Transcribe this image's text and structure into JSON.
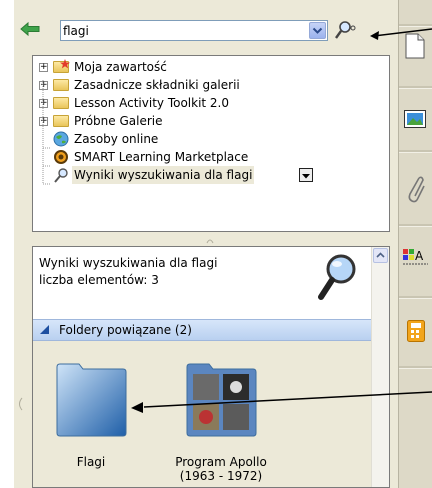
{
  "search": {
    "value": "flagi"
  },
  "tree": {
    "items": [
      {
        "label": "Moja zawartość"
      },
      {
        "label": "Zasadnicze składniki galerii"
      },
      {
        "label": "Lesson Activity Toolkit 2.0"
      },
      {
        "label": "Próbne Galerie"
      },
      {
        "label": "Zasoby online"
      },
      {
        "label": "SMART Learning Marketplace"
      },
      {
        "label": "Wyniki wyszukiwania dla flagi"
      }
    ]
  },
  "results": {
    "title": "Wyniki wyszukiwania dla flagi",
    "count": "liczba elementów: 3",
    "group_label": "Foldery powiązane (2)",
    "items": [
      {
        "label": "Flagi"
      },
      {
        "label_line1": "Program Apollo",
        "label_line2": "(1963 - 1972)"
      }
    ]
  },
  "colors": {
    "panel_bg": "#ece9d8",
    "group_header": "#c9dbf4",
    "selection": "#ece9d8"
  }
}
